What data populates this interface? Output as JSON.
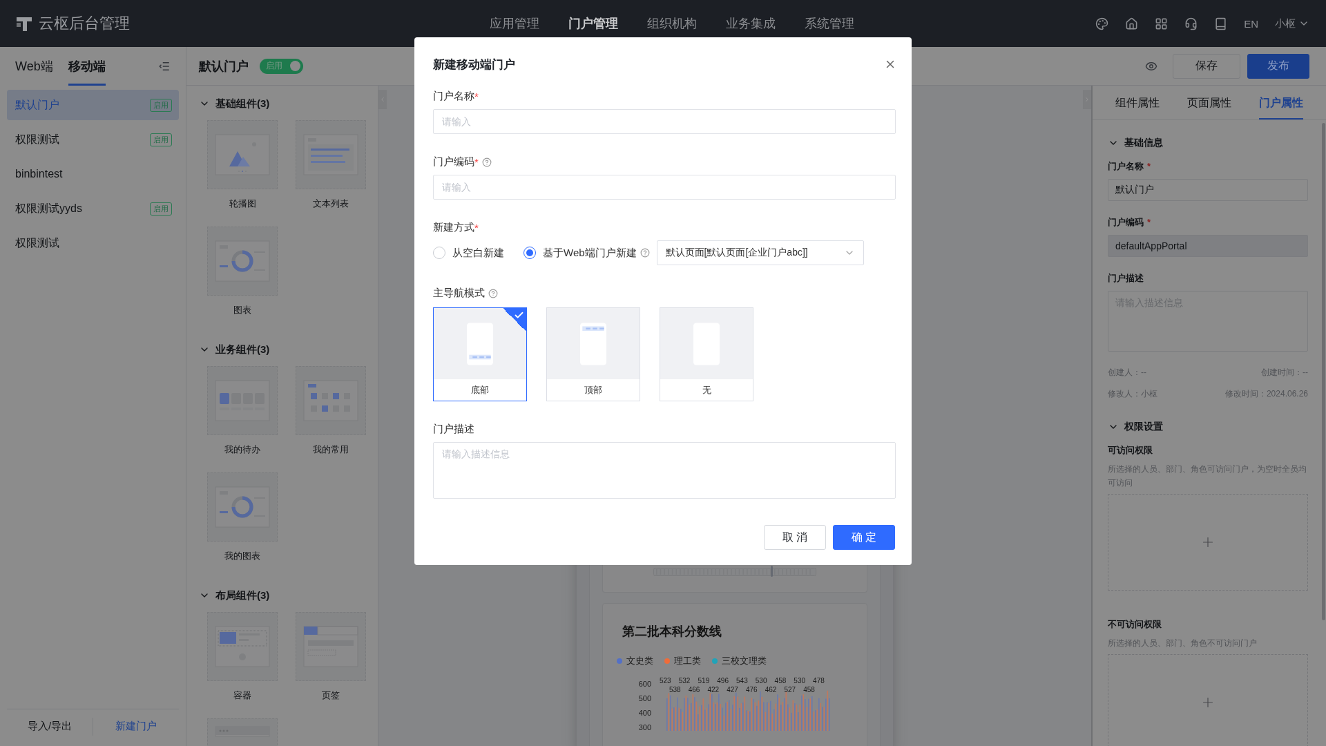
{
  "top_bar": {
    "title": "云枢后台管理",
    "nav": [
      {
        "label": "应用管理",
        "selected": false
      },
      {
        "label": "门户管理",
        "selected": true
      },
      {
        "label": "组织机构",
        "selected": false
      },
      {
        "label": "业务集成",
        "selected": false
      },
      {
        "label": "系统管理",
        "selected": false
      }
    ],
    "language": "EN",
    "user": "小枢"
  },
  "sidebar": {
    "tabs": [
      {
        "label": "Web端",
        "selected": false
      },
      {
        "label": "移动端",
        "selected": true
      }
    ],
    "portals": [
      {
        "name": "默认门户",
        "badge": "启用",
        "selected": true
      },
      {
        "name": "权限测试",
        "badge": "启用",
        "selected": false
      },
      {
        "name": "binbintest",
        "selected": false
      },
      {
        "name": "权限测试yyds",
        "badge": "启用",
        "selected": false
      },
      {
        "name": "权限测试",
        "selected": false
      }
    ],
    "footer_actions": [
      {
        "label": "导入/导出",
        "kind": "default"
      },
      {
        "label": "新建门户",
        "kind": "link"
      }
    ]
  },
  "toolbar": {
    "portal_name": "默认门户",
    "status": {
      "label": "启用",
      "on": true
    },
    "buttons": [
      {
        "label": "保存",
        "kind": "default"
      },
      {
        "label": "发布",
        "kind": "primary"
      }
    ]
  },
  "component_panel": {
    "sections": [
      {
        "title": "基础组件(3)",
        "expanded": true,
        "items": [
          {
            "label": "轮播图",
            "kind": "carousel"
          },
          {
            "label": "文本列表",
            "kind": "text-list"
          },
          {
            "label": "图表",
            "kind": "chart"
          }
        ]
      },
      {
        "title": "业务组件(3)",
        "expanded": true,
        "items": [
          {
            "label": "我的待办",
            "kind": "todo"
          },
          {
            "label": "我的常用",
            "kind": "favorites"
          },
          {
            "label": "我的图表",
            "kind": "chart"
          }
        ]
      },
      {
        "title": "布局组件(3)",
        "expanded": true,
        "items": [
          {
            "label": "容器",
            "kind": "container"
          },
          {
            "label": "页签",
            "kind": "tabs"
          },
          {
            "kind": "header"
          }
        ]
      }
    ]
  },
  "preview": {
    "chart_card": {
      "title": "第二批本科分数线",
      "legend": [
        {
          "label": "文史类",
          "color": "#5470c6"
        },
        {
          "label": "理工类",
          "color": "#ee6c3a"
        },
        {
          "label": "三校文理类",
          "color": "#22a3b8"
        }
      ],
      "y_tick_labels": [
        "600",
        "500",
        "400",
        "300"
      ],
      "value_labels": [
        "523",
        "538",
        "532",
        "466",
        "519",
        "422",
        "496",
        "427",
        "543",
        "476",
        "530",
        "462",
        "458",
        "527",
        "530",
        "458",
        "478"
      ]
    }
  },
  "properties_panel": {
    "tabs": [
      {
        "label": "组件属性",
        "selected": false
      },
      {
        "label": "页面属性",
        "selected": false
      },
      {
        "label": "门户属性",
        "selected": true
      }
    ],
    "sections": [
      {
        "kind": "form",
        "title": "基础信息",
        "expanded": true,
        "fields": [
          {
            "kind": "input",
            "label": "门户名称",
            "required_mark": "*",
            "value": "默认门户",
            "disabled": false
          },
          {
            "kind": "input",
            "label": "门户编码",
            "required_mark": "*",
            "value": "defaultAppPortal",
            "disabled": true
          },
          {
            "kind": "textarea",
            "label": "门户描述",
            "placeholder": "请输入描述信息"
          }
        ],
        "meta": [
          {
            "left": "创建人：--",
            "right": "创建时间：--"
          },
          {
            "left": "修改人：小枢",
            "right": "修改时间：2024.06.26"
          }
        ]
      },
      {
        "kind": "permissions",
        "title": "权限设置",
        "expanded": true,
        "groups": [
          {
            "title": "可访问权限",
            "description": "所选择的人员、部门、角色可访问门户，为空时全员均可访问"
          },
          {
            "title": "不可访问权限",
            "description": "所选择的人员、部门、角色不可访问门户"
          }
        ]
      }
    ]
  },
  "dialog": {
    "title": "新建移动端门户",
    "fields": [
      {
        "kind": "input",
        "label": "门户名称",
        "required_mark": "*",
        "help": false,
        "placeholder": "请输入"
      },
      {
        "kind": "input",
        "label": "门户编码",
        "required_mark": "*",
        "help": true,
        "placeholder": "请输入"
      },
      {
        "kind": "creation",
        "label": "新建方式",
        "required_mark": "*",
        "help": false,
        "options": [
          {
            "label": "从空白新建",
            "selected": false,
            "help": false
          },
          {
            "label": "基于Web端门户新建",
            "selected": true,
            "help": true
          }
        ],
        "select_value": "默认页面[默认页面[企业门户abc]]"
      },
      {
        "kind": "nav-modes",
        "label": "主导航模式",
        "help": true,
        "options": [
          {
            "label": "底部",
            "kind": "bottom",
            "selected": true
          },
          {
            "label": "顶部",
            "kind": "top",
            "selected": false
          },
          {
            "label": "无",
            "kind": "none",
            "selected": false
          }
        ]
      },
      {
        "kind": "textarea",
        "label": "门户描述",
        "help": false,
        "placeholder": "请输入描述信息"
      }
    ],
    "buttons": [
      {
        "label": "取 消",
        "kind": "default"
      },
      {
        "label": "确 定",
        "kind": "primary"
      }
    ]
  }
}
